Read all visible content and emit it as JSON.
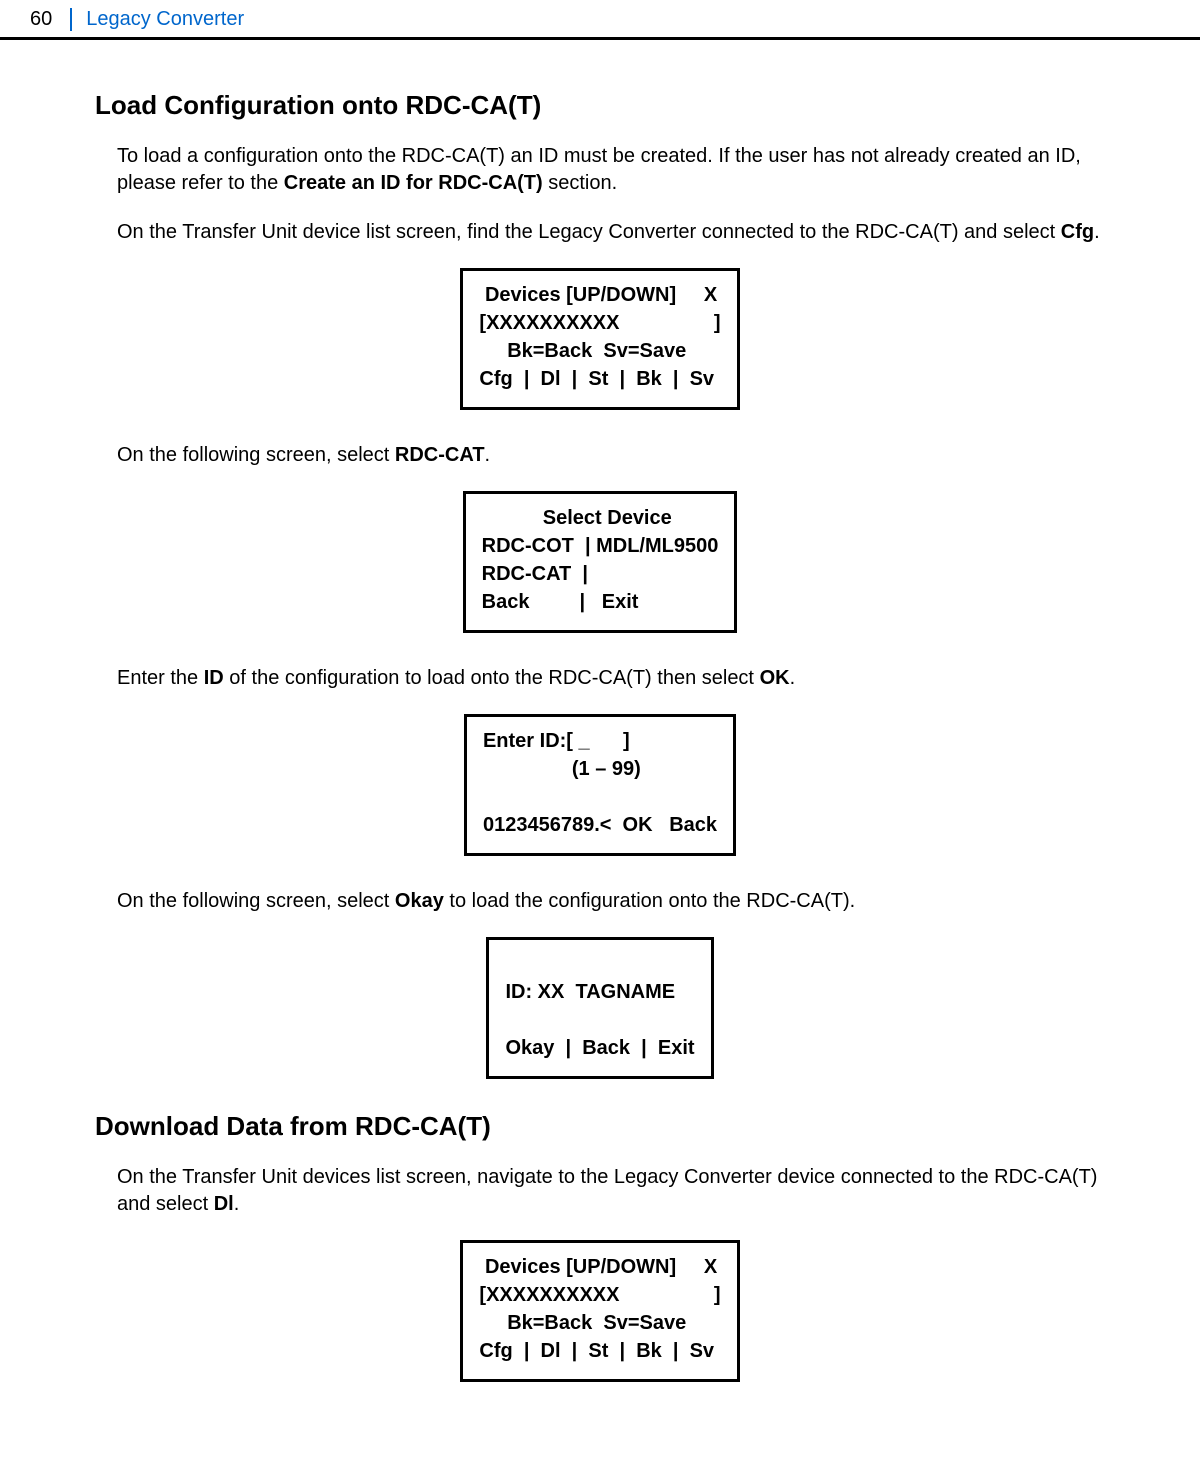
{
  "header": {
    "page_number": "60",
    "title": "Legacy Converter"
  },
  "section1": {
    "heading": "Load Configuration onto RDC-CA(T)",
    "para1_a": "To load a configuration onto the RDC-CA(T) an ID must be created. If the user has not already created an ID, please refer to the ",
    "para1_bold": "Create an ID for RDC-CA(T)",
    "para1_b": " section.",
    "para2_a": "On the Transfer Unit device list screen, find the Legacy Converter connected to the RDC-CA(T) and select ",
    "para2_bold": "Cfg",
    "para2_b": ".",
    "lcd1": " Devices [UP/DOWN]     X\n[XXXXXXXXXX                 ]\n     Bk=Back  Sv=Save\nCfg  |  Dl  |  St  |  Bk  |  Sv",
    "para3_a": "On the following screen, select ",
    "para3_bold": "RDC-CAT",
    "para3_b": ".",
    "lcd2": "           Select Device\nRDC-COT  | MDL/ML9500\nRDC-CAT  |\nBack         |   Exit",
    "para4_a": "Enter the ",
    "para4_bold1": "ID",
    "para4_mid": " of the configuration to load onto the RDC-CA(T) then select ",
    "para4_bold2": "OK",
    "para4_b": ".",
    "lcd3": "Enter ID:[ _      ]\n                (1 – 99)\n\n0123456789.<  OK   Back",
    "para5_a": "On the following screen, select ",
    "para5_bold": "Okay",
    "para5_b": " to load the configuration onto the RDC-CA(T).",
    "lcd4": "\nID: XX  TAGNAME\n\nOkay  |  Back  |  Exit"
  },
  "section2": {
    "heading": "Download Data from RDC-CA(T)",
    "para1_a": "On the Transfer Unit devices list screen, navigate to the Legacy Converter device connected to the RDC-CA(T) and select ",
    "para1_bold": "Dl",
    "para1_b": ".",
    "lcd1": " Devices [UP/DOWN]     X\n[XXXXXXXXXX                 ]\n     Bk=Back  Sv=Save\nCfg  |  Dl  |  St  |  Bk  |  Sv"
  }
}
